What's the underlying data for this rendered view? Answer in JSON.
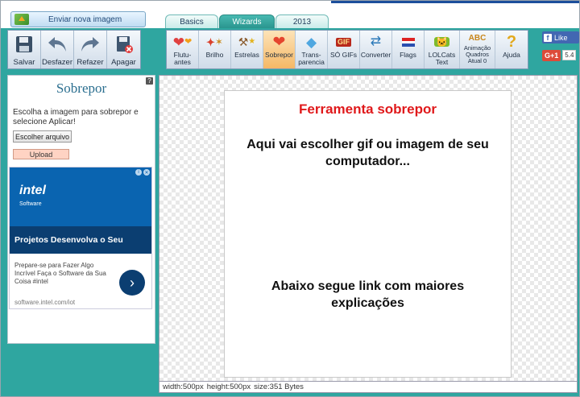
{
  "header": {
    "upload_new_label": "Enviar nova imagem"
  },
  "tabs": [
    {
      "label": "Basics",
      "active": false
    },
    {
      "label": "Wizards",
      "active": true
    },
    {
      "label": "2013",
      "active": false
    }
  ],
  "toolbar_left": [
    {
      "label": "Salvar",
      "icon": "floppy-disk-icon"
    },
    {
      "label": "Desfazer",
      "icon": "undo-arrow-icon"
    },
    {
      "label": "Refazer",
      "icon": "redo-arrow-icon"
    },
    {
      "label": "Apagar",
      "icon": "delete-icon"
    }
  ],
  "wizard_tools": [
    {
      "label": "Flutu-\nantes",
      "icon": "floating-hearts-icon",
      "active": false
    },
    {
      "label": "Brilho",
      "icon": "sparkle-text-icon",
      "active": false
    },
    {
      "label": "Estrelas",
      "icon": "star-wand-icon",
      "active": false
    },
    {
      "label": "Sobrepor",
      "icon": "overlay-hearts-icon",
      "active": true
    },
    {
      "label": "Trans-\nparencia",
      "icon": "diamond-icon",
      "active": false
    },
    {
      "label": "SÓ GIFs",
      "icon": "gif-badge-icon",
      "active": false
    },
    {
      "label": "Converter",
      "icon": "convert-icon",
      "active": false
    },
    {
      "label": "Flags",
      "icon": "flag-icon",
      "active": false
    },
    {
      "label": "LOLCats\nText",
      "icon": "lolcat-icon",
      "active": false
    },
    {
      "label": "Animação\nQuadros\nAtual 0",
      "icon": "abc-blocks-icon",
      "active": false
    },
    {
      "label": "Ajuda",
      "icon": "question-mark-icon",
      "active": false
    }
  ],
  "social": {
    "fb_label": "Like",
    "gplus_label": "G+1",
    "gplus_count": "5.4"
  },
  "panel": {
    "title": "Sobrepor",
    "description": "Escolha a imagem para sobrepor e selecione Aplicar!",
    "choose_file_label": "Escolher arquivo",
    "upload_label": "Upload",
    "help_icon": "?"
  },
  "ad": {
    "brand": "intel",
    "brand_sub": "Software",
    "headline": "Projetos Desenvolva o Seu",
    "body": "Prepare-se para Fazer Algo Incrível Faça o Software da Sua Coisa #intel",
    "url": "software.intel.com/iot",
    "arrow": "›"
  },
  "image": {
    "title": "Ferramenta sobrepor",
    "line1": "Aqui vai escolher gif ou imagem de seu computador...",
    "line2": "Abaixo segue link com maiores explicações"
  },
  "status": {
    "width": "width:500px",
    "height": "height:500px",
    "size": "size:351 Bytes"
  },
  "colors": {
    "accent_teal": "#2fa6a0",
    "active_tool": "#f5b865",
    "title_red": "#e0191b"
  }
}
